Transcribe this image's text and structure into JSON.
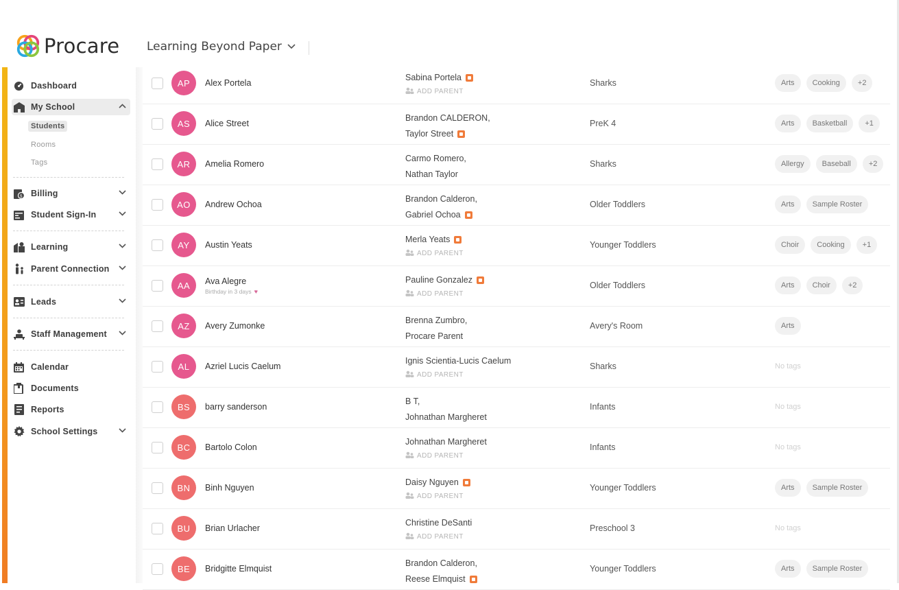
{
  "brand": {
    "name": "Procare"
  },
  "header": {
    "school_name": "Learning Beyond Paper"
  },
  "colors": {
    "accent": "#f2b515",
    "avatar_pink": "#e6588e",
    "avatar_coral": "#ee6d6d",
    "parent_lock": "#f07b3a"
  },
  "sidebar": {
    "dashboard": "Dashboard",
    "my_school": "My School",
    "students": "Students",
    "rooms": "Rooms",
    "tags": "Tags",
    "billing": "Billing",
    "student_sign_in": "Student Sign-In",
    "learning": "Learning",
    "parent_connection": "Parent Connection",
    "leads": "Leads",
    "staff_management": "Staff Management",
    "calendar": "Calendar",
    "documents": "Documents",
    "reports": "Reports",
    "school_settings": "School Settings"
  },
  "labels": {
    "add_parent": "ADD PARENT",
    "no_tags": "No tags"
  },
  "students": [
    {
      "initials": "AP",
      "name": "Alex Portela",
      "color": "pink",
      "parents": [
        {
          "text": "Sabina Portela",
          "lock": true
        }
      ],
      "add_parent": true,
      "room": "Sharks",
      "tags": [
        "Arts",
        "Cooking",
        "+2"
      ]
    },
    {
      "initials": "AS",
      "name": "Alice Street",
      "color": "pink",
      "parents": [
        {
          "text": "Brandon CALDERON,",
          "lock": false
        },
        {
          "text": "Taylor Street",
          "lock": true
        }
      ],
      "add_parent": false,
      "room": "PreK 4",
      "tags": [
        "Arts",
        "Basketball",
        "+1"
      ]
    },
    {
      "initials": "AR",
      "name": "Amelia Romero",
      "color": "pink",
      "parents": [
        {
          "text": "Carmo Romero,",
          "lock": false
        },
        {
          "text": "Nathan Taylor",
          "lock": false
        }
      ],
      "add_parent": false,
      "room": "Sharks",
      "tags": [
        "Allergy",
        "Baseball",
        "+2"
      ]
    },
    {
      "initials": "AO",
      "name": "Andrew Ochoa",
      "color": "pink",
      "parents": [
        {
          "text": "Brandon Calderon,",
          "lock": false
        },
        {
          "text": "Gabriel Ochoa",
          "lock": true
        }
      ],
      "add_parent": false,
      "room": "Older Toddlers",
      "tags": [
        "Arts",
        "Sample Roster"
      ]
    },
    {
      "initials": "AY",
      "name": "Austin Yeats",
      "color": "pink",
      "parents": [
        {
          "text": "Merla Yeats",
          "lock": true
        }
      ],
      "add_parent": true,
      "room": "Younger Toddlers",
      "tags": [
        "Choir",
        "Cooking",
        "+1"
      ]
    },
    {
      "initials": "AA",
      "name": "Ava Alegre",
      "subtext": "Birthday in 3 days",
      "color": "pink",
      "parents": [
        {
          "text": "Pauline Gonzalez",
          "lock": true
        }
      ],
      "add_parent": true,
      "room": "Older Toddlers",
      "tags": [
        "Arts",
        "Choir",
        "+2"
      ]
    },
    {
      "initials": "AZ",
      "name": "Avery Zumonke",
      "color": "pink",
      "parents": [
        {
          "text": "Brenna Zumbro,",
          "lock": false
        },
        {
          "text": "Procare Parent",
          "lock": false
        }
      ],
      "add_parent": false,
      "room": "Avery's Room",
      "tags": [
        "Arts"
      ]
    },
    {
      "initials": "AL",
      "name": "Azriel Lucis Caelum",
      "color": "pink",
      "parents": [
        {
          "text": "Ignis Scientia-Lucis Caelum",
          "lock": false
        }
      ],
      "add_parent": true,
      "room": "Sharks",
      "tags": []
    },
    {
      "initials": "BS",
      "name": "barry sanderson",
      "color": "coral",
      "parents": [
        {
          "text": "B T,",
          "lock": false
        },
        {
          "text": "Johnathan Margheret",
          "lock": false
        }
      ],
      "add_parent": false,
      "room": "Infants",
      "tags": []
    },
    {
      "initials": "BC",
      "name": "Bartolo Colon",
      "color": "coral",
      "parents": [
        {
          "text": "Johnathan Margheret",
          "lock": false
        }
      ],
      "add_parent": true,
      "room": "Infants",
      "tags": []
    },
    {
      "initials": "BN",
      "name": "Binh Nguyen",
      "color": "coral",
      "parents": [
        {
          "text": "Daisy Nguyen",
          "lock": true
        }
      ],
      "add_parent": true,
      "room": "Younger Toddlers",
      "tags": [
        "Arts",
        "Sample Roster"
      ]
    },
    {
      "initials": "BU",
      "name": "Brian Urlacher",
      "color": "coral",
      "parents": [
        {
          "text": "Christine DeSanti",
          "lock": false
        }
      ],
      "add_parent": true,
      "room": "Preschool 3",
      "tags": []
    },
    {
      "initials": "BE",
      "name": "Bridgitte Elmquist",
      "color": "coral",
      "parents": [
        {
          "text": "Brandon Calderon,",
          "lock": false
        },
        {
          "text": "Reese Elmquist",
          "lock": true
        }
      ],
      "add_parent": false,
      "room": "Younger Toddlers",
      "tags": [
        "Arts",
        "Sample Roster"
      ]
    }
  ]
}
